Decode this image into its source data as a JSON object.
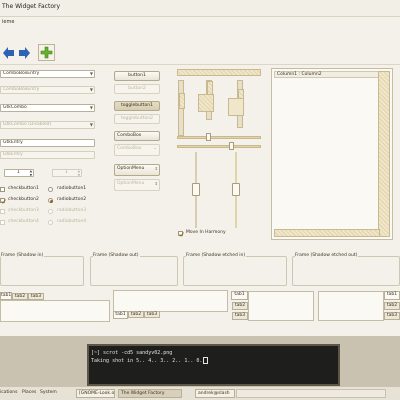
{
  "window": {
    "title": "The Widget Factory",
    "menu_label": "ieme"
  },
  "combos": {
    "combo_entry": "ComboBoxEntry",
    "combo_entry_disabled": "ComboBoxEntry",
    "gtk_combo": "GtkCombo",
    "gtk_combo_disabled": "GtkCombo (Disabled)",
    "gtk_entry": "GtkEntry",
    "gtk_entry_disabled": "GtkEntry",
    "spin_value": "1",
    "spin_value_disabled": "1"
  },
  "checks": [
    {
      "label": "checkbutton1",
      "checked": false
    },
    {
      "label": "checkbutton2",
      "checked": true
    },
    {
      "label": "checkbutton3",
      "checked": false
    },
    {
      "label": "checkbutton4",
      "checked": false
    }
  ],
  "radios": [
    {
      "label": "radiobutton1",
      "selected": false
    },
    {
      "label": "radiobutton2",
      "selected": true
    },
    {
      "label": "radiobutton3",
      "selected": false
    },
    {
      "label": "radiobutton4",
      "selected": false
    }
  ],
  "buttons": {
    "button1": "button1",
    "button2": "button2",
    "toggle1": "togglebutton1",
    "toggle2": "togglebutton2",
    "combobox": "ComboBox",
    "combobox_disabled": "ComboBox",
    "optionmenu": "OptionMenu",
    "optionmenu_disabled": "OptionMenu"
  },
  "harmony": {
    "label": "Move In Harmony",
    "checked": true
  },
  "list": {
    "columns": "Column1 : Column2"
  },
  "frames": [
    "Frame (Shadow in)",
    "Frame (Shadow out)",
    "Frame (Shadow etched in)",
    "Frame (Shadow etched out)"
  ],
  "tabsets": {
    "top": [
      "tab1",
      "tab2",
      "tab3"
    ],
    "bottom": [
      "tab1",
      "tab2",
      "tab3"
    ],
    "left": [
      "tab1",
      "tab2",
      "tab3"
    ],
    "right": [
      "tab1",
      "tab2",
      "tab3"
    ]
  },
  "terminal": {
    "line1": "[~] scrot -cd5 sandyv02.png",
    "line2": "Taking shot in 5.. 4.. 3.. 2.. 1.. 0."
  },
  "taskbar": {
    "left_items": [
      "ications",
      "Places",
      "System"
    ],
    "windows": [
      {
        "label": "[GNOME-Look.org - S...",
        "active": false
      },
      {
        "label": "The Widget Factory",
        "active": true
      },
      {
        "label": "andrek@slash",
        "active": false
      }
    ]
  },
  "colors": {
    "accent": "#d9c48a",
    "window_bg": "#f4f1ea",
    "terminal_bg": "#1e1e1c"
  }
}
